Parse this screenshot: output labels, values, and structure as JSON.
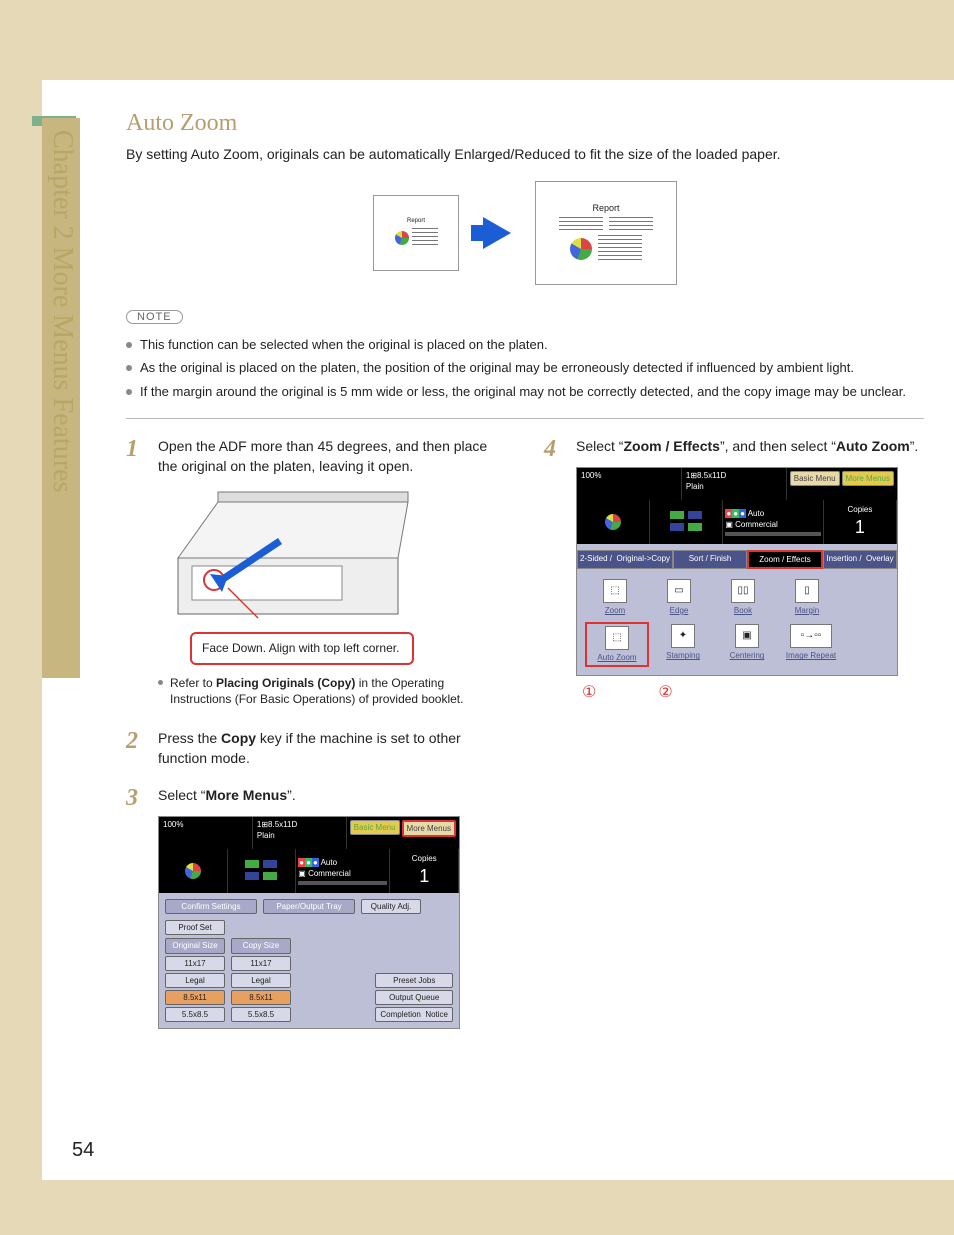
{
  "sidebar_text": "Chapter 2    More Menus Features",
  "title": "Auto Zoom",
  "description": "By setting Auto Zoom, originals can be automatically Enlarged/Reduced to fit the size of the loaded paper.",
  "illu_small_label": "Report",
  "illu_big_label": "Report",
  "note_label": "NOTE",
  "notes": [
    "This function can be selected when the original is placed on the platen.",
    "As the original is placed on the platen, the position of the original may be erroneously detected if influenced by ambient light.",
    "If the margin around the original is 5 mm wide or less, the original may not be correctly detected, and the copy image may be unclear."
  ],
  "steps": {
    "s1": {
      "num": "1",
      "text_a": "Open the ADF more than 45 degrees, and then place the original on the platen, leaving it open."
    },
    "s1_callout": "Face Down. Align with top left corner.",
    "s1_bullet_pre": "Refer to ",
    "s1_bullet_bold": "Placing Originals (Copy)",
    "s1_bullet_post": " in the Operating Instructions (For Basic Operations) of provided booklet.",
    "s2": {
      "num": "2",
      "text_a": "Press the ",
      "bold": "Copy",
      "text_b": " key if the machine is set to other function mode."
    },
    "s3": {
      "num": "3",
      "text_a": "Select “",
      "bold": "More Menus",
      "text_b": "”."
    },
    "s4": {
      "num": "4",
      "text_a": "Select “",
      "bold1": "Zoom / Effects",
      "mid": "”, and then select “",
      "bold2": "Auto Zoom",
      "text_b": "”."
    }
  },
  "screen1": {
    "top_left": "100%",
    "top_mid": "1⊞8.5x11D\nPlain",
    "menu_basic": "Basic Menu",
    "menu_more": "More Menus",
    "mid_auto": "Auto",
    "mid_commercial": "Commercial",
    "mid_copies": "Copies",
    "mid_count": "1",
    "btn_confirm": "Confirm Settings",
    "btn_paper": "Paper/Output Tray",
    "btn_quality": "Quality Adj.",
    "btn_proof": "Proof Set",
    "col1_head": "Original Size",
    "col2_head": "Copy Size",
    "sizes": [
      "11x17",
      "Legal",
      "8.5x11",
      "5.5x8.5"
    ],
    "right_btns": [
      "Preset Jobs",
      "Output Queue",
      "Completion  Notice"
    ]
  },
  "screen2": {
    "top_left": "100%",
    "top_mid": "1⊞8.5x11D\nPlain",
    "menu_basic": "Basic Menu",
    "menu_more": "More Menus",
    "mid_auto": "Auto",
    "mid_commercial": "Commercial",
    "mid_copies": "Copies",
    "mid_count": "1",
    "tabs": [
      "2-Sided /  Original->Copy",
      "Sort / Finish",
      "Zoom / Effects",
      "Insertion /  Overlay"
    ],
    "icons": [
      "Zoom",
      "Edge",
      "Book",
      "Margin",
      "Auto Zoom",
      "Stamping",
      "Centering",
      "Image Repeat"
    ]
  },
  "circled": {
    "one": "①",
    "two": "②"
  },
  "page_number": "54"
}
